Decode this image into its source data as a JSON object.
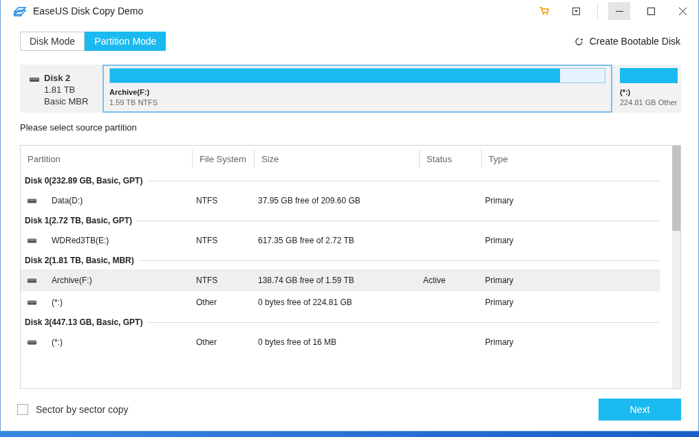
{
  "window": {
    "title": "EaseUS Disk Copy Demo"
  },
  "tabs": [
    {
      "label": "Disk Mode",
      "selected": false
    },
    {
      "label": "Partition Mode",
      "selected": true
    }
  ],
  "bootable_link": "Create Bootable Disk",
  "disk_map": {
    "name": "Disk 2",
    "capacity": "1.81 TB",
    "style": "Basic MBR",
    "partitions": [
      {
        "name": "Archive(F:)",
        "detail": "1.59 TB NTFS",
        "level": 0.91,
        "selected": true
      },
      {
        "name": "(*:)",
        "detail": "224.81 GB Other",
        "level": 1,
        "selected": false
      }
    ]
  },
  "instruction": "Please select source partition",
  "table": {
    "columns": [
      "Partition",
      "File System",
      "Size",
      "Status",
      "Type"
    ],
    "groups": [
      {
        "header": "Disk 0(232.89 GB, Basic, GPT)",
        "rows": [
          {
            "partition": "Data(D:)",
            "file_system": "NTFS",
            "size": "37.95 GB free of 209.60 GB",
            "status": "",
            "type": "Primary",
            "selected": false
          }
        ]
      },
      {
        "header": "Disk 1(2.72 TB, Basic, GPT)",
        "rows": [
          {
            "partition": "WDRed3TB(E:)",
            "file_system": "NTFS",
            "size": "617.35 GB free of 2.72 TB",
            "status": "",
            "type": "Primary",
            "selected": false
          }
        ]
      },
      {
        "header": "Disk 2(1.81 TB, Basic, MBR)",
        "rows": [
          {
            "partition": "Archive(F:)",
            "file_system": "NTFS",
            "size": "138.74 GB free of 1.59 TB",
            "status": "Active",
            "type": "Primary",
            "selected": true
          },
          {
            "partition": "(*:)",
            "file_system": "Other",
            "size": "0 bytes free of 224.81 GB",
            "status": "",
            "type": "Primary",
            "selected": false
          }
        ]
      },
      {
        "header": "Disk 3(447.13 GB, Basic, GPT)",
        "rows": [
          {
            "partition": "(*:)",
            "file_system": "Other",
            "size": "0 bytes free of 16 MB",
            "status": "",
            "type": "Primary",
            "selected": false
          }
        ]
      }
    ]
  },
  "sector_copy": {
    "label": "Sector by sector copy",
    "checked": false
  },
  "next_button": "Next"
}
